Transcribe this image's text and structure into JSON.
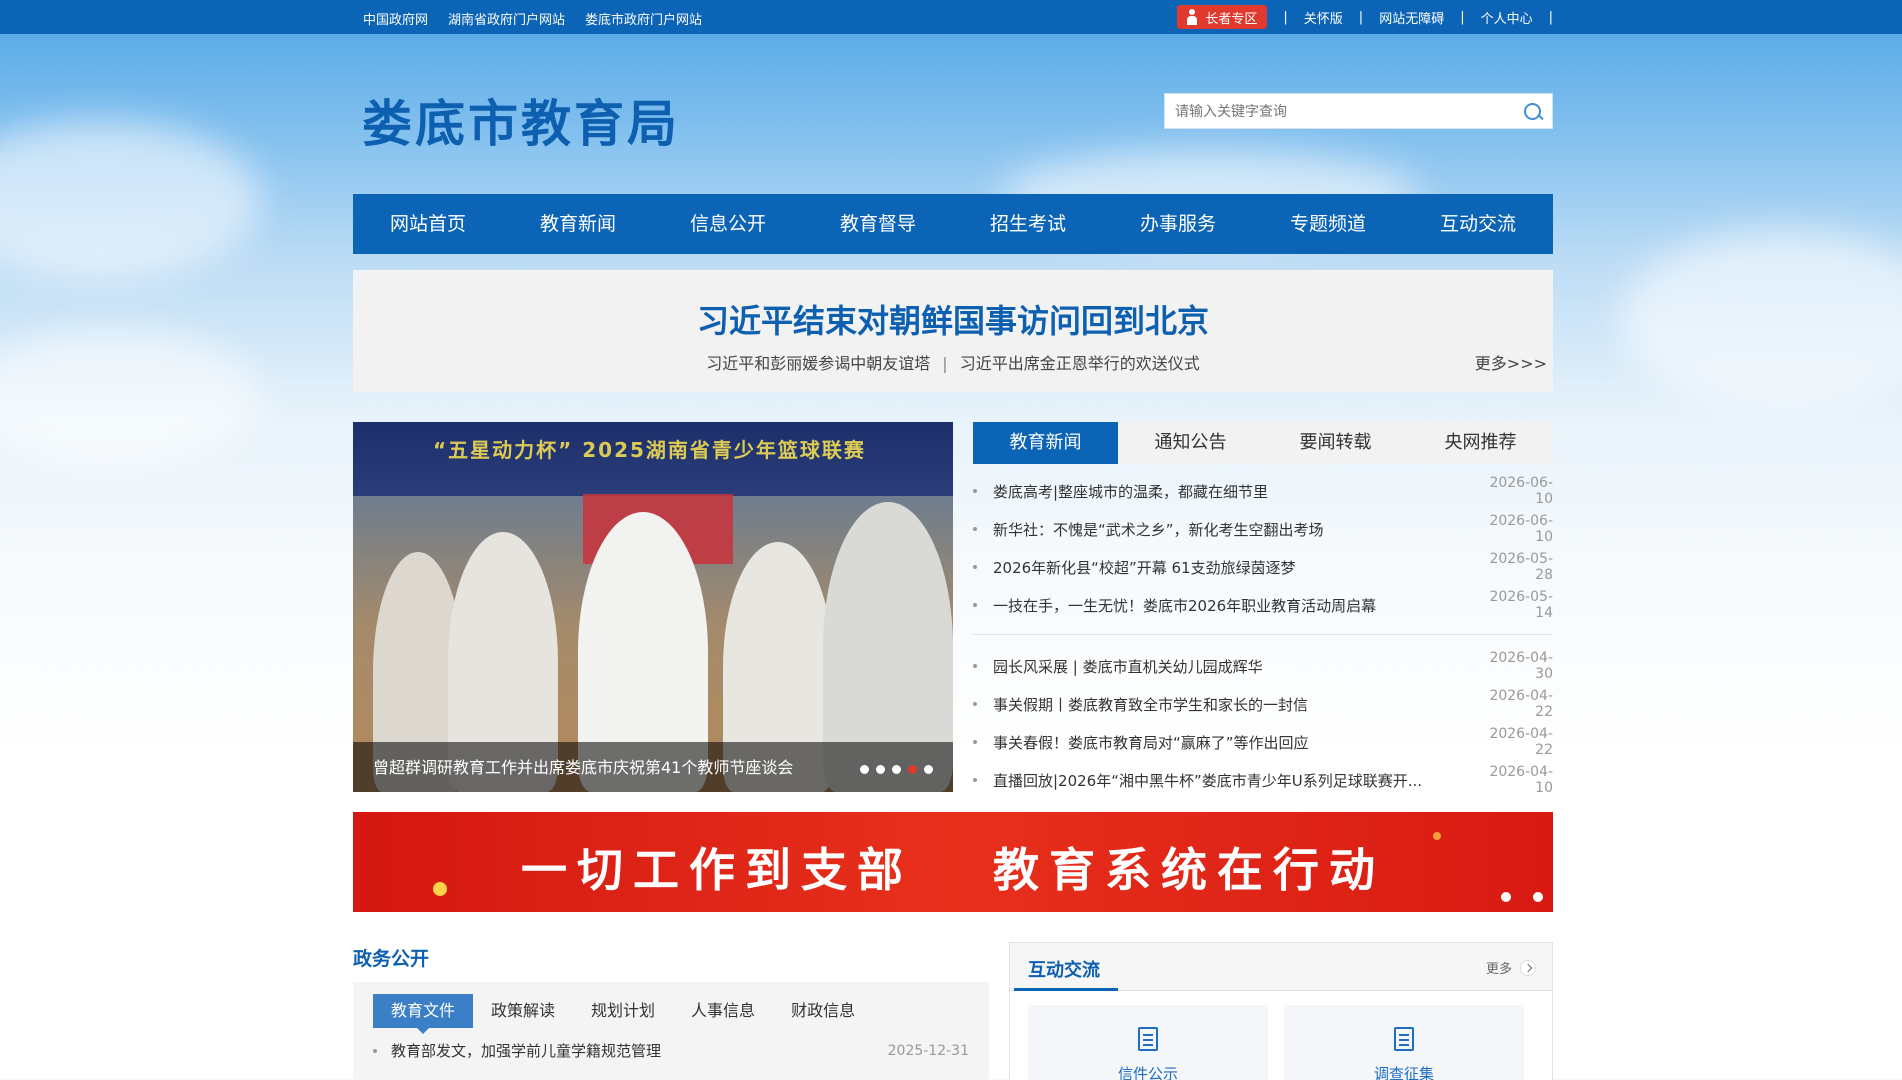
{
  "topbar": {
    "links": [
      "中国政府网",
      "湖南省政府门户网站",
      "娄底市政府门户网站"
    ],
    "elder": "长者专区",
    "right_links": [
      "关怀版",
      "网站无障碍",
      "个人中心"
    ]
  },
  "header": {
    "logo": "娄底市教育局",
    "search_placeholder": "请输入关键字查询"
  },
  "nav": [
    "网站首页",
    "教育新闻",
    "信息公开",
    "教育督导",
    "招生考试",
    "办事服务",
    "专题频道",
    "互动交流"
  ],
  "headline": {
    "title": "习近平结束对朝鲜国事访问回到北京",
    "subs": [
      "习近平和彭丽媛参谒中朝友谊塔",
      "习近平出席金正恩举行的欢送仪式"
    ],
    "more": "更多>>>"
  },
  "slider": {
    "banner_text": "“五星动力杯” 2025湖南省青少年篮球联赛",
    "caption": "曾超群调研教育工作并出席娄底市庆祝第41个教师节座谈会",
    "dot_count": 5,
    "active_dot": 4
  },
  "news": {
    "tabs": [
      "教育新闻",
      "通知公告",
      "要闻转载",
      "央网推荐"
    ],
    "group1": [
      {
        "title": "娄底高考|整座城市的温柔，都藏在细节里",
        "date": "2026-06-10"
      },
      {
        "title": "新华社：不愧是“武术之乡”，新化考生空翻出考场",
        "date": "2026-06-10"
      },
      {
        "title": "2026年新化县“校超”开幕 61支劲旅绿茵逐梦",
        "date": "2026-05-28"
      },
      {
        "title": "一技在手，一生无忧！娄底市2026年职业教育活动周启幕",
        "date": "2026-05-14"
      }
    ],
    "group2": [
      {
        "title": "园长风采展 | 娄底市直机关幼儿园成辉华",
        "date": "2026-04-30"
      },
      {
        "title": "事关假期丨娄底教育致全市学生和家长的一封信",
        "date": "2026-04-22"
      },
      {
        "title": "事关春假！娄底市教育局对“赢麻了”等作出回应",
        "date": "2026-04-22"
      },
      {
        "title": "直播回放|2026年“湘中黑牛杯”娄底市青少年U系列足球联赛开...",
        "date": "2026-04-10"
      }
    ]
  },
  "promo": {
    "left": "一切工作到支部",
    "right": "教育系统在行动"
  },
  "gov": {
    "title": "政务公开",
    "tabs": [
      "教育文件",
      "政策解读",
      "规划计划",
      "人事信息",
      "财政信息"
    ],
    "row": {
      "title": "教育部发文，加强学前儿童学籍规范管理",
      "date": "2025-12-31"
    }
  },
  "interact": {
    "title": "互动交流",
    "more": "更多",
    "cards": [
      "信件公示",
      "调查征集"
    ]
  }
}
